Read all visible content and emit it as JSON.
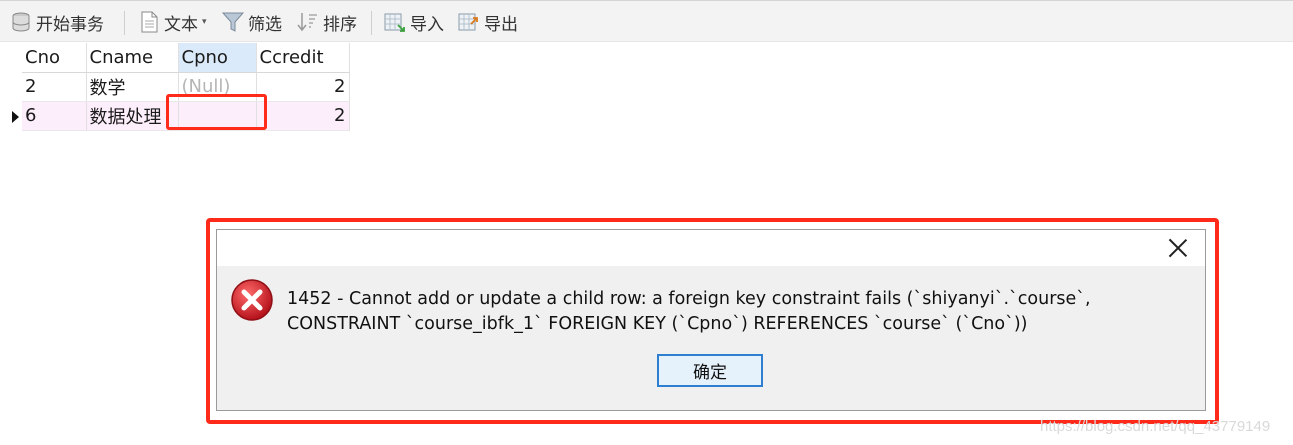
{
  "toolbar": {
    "begin_tx_label": "开始事务",
    "text_label": "文本",
    "filter_label": "筛选",
    "sort_label": "排序",
    "import_label": "导入",
    "export_label": "导出"
  },
  "table": {
    "columns": [
      "Cno",
      "Cname",
      "Cpno",
      "Ccredit"
    ],
    "rows": [
      {
        "Cno": "2",
        "Cname": "数学",
        "Cpno": "(Null)",
        "Ccredit": "2"
      },
      {
        "Cno": "6",
        "Cname": "数据处理",
        "Cpno": "",
        "Ccredit": "2"
      }
    ]
  },
  "dialog": {
    "message": "1452 - Cannot add or update a child row: a foreign key constraint fails (`shiyanyi`.`course`, CONSTRAINT `course_ibfk_1` FOREIGN KEY (`Cpno`) REFERENCES `course` (`Cno`))",
    "ok_label": "确定"
  },
  "watermark": "https://blog.csdn.net/qq_43779149",
  "colors": {
    "highlight": "#ff2a1a",
    "error_icon": "#d9262b",
    "selected_header": "#dbeafb",
    "current_row": "#fdeefb"
  }
}
